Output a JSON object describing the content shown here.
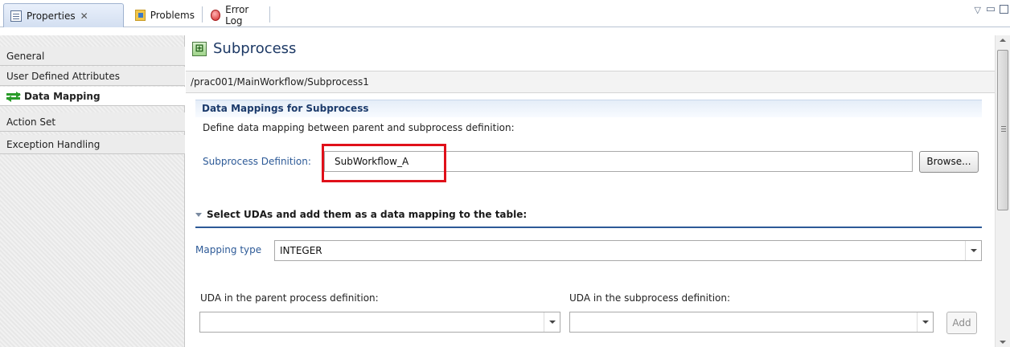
{
  "tabs": [
    {
      "label": "Properties",
      "close": "✕",
      "icon": "properties-icon",
      "active": true
    },
    {
      "label": "Problems",
      "icon": "problems-icon",
      "active": false
    },
    {
      "label": "Error Log",
      "icon": "error-log-icon",
      "active": false
    }
  ],
  "view_controls": {
    "menu": "▽",
    "minimize": "▭",
    "maximize": "□"
  },
  "nav": {
    "items": [
      {
        "label": "General"
      },
      {
        "label": "User Defined Attributes"
      },
      {
        "label": "Data Mapping",
        "selected": true
      },
      {
        "label": "Action Set"
      },
      {
        "label": "Exception Handling"
      }
    ]
  },
  "header": {
    "icon": "⊞",
    "title": "Subprocess",
    "path": "/prac001/MainWorkflow/Subprocess1"
  },
  "section": {
    "title": "Data Mappings for Subprocess",
    "description": "Define data mapping between parent and subprocess definition:"
  },
  "subprocess_def": {
    "label": "Subprocess Definition:",
    "value": "SubWorkflow_A",
    "browse_label": "Browse..."
  },
  "uda_section": {
    "title": "Select UDAs and add them as a data mapping to the table:",
    "mapping_type_label": "Mapping type",
    "mapping_type_value": "INTEGER",
    "parent_label": "UDA in the parent process definition:",
    "parent_value": "",
    "child_label": "UDA in the subprocess definition:",
    "child_value": "",
    "add_label": "Add"
  },
  "colors": {
    "accent": "#2d5a97",
    "highlight": "#e0101a",
    "section_bg": "#e5edf8"
  }
}
